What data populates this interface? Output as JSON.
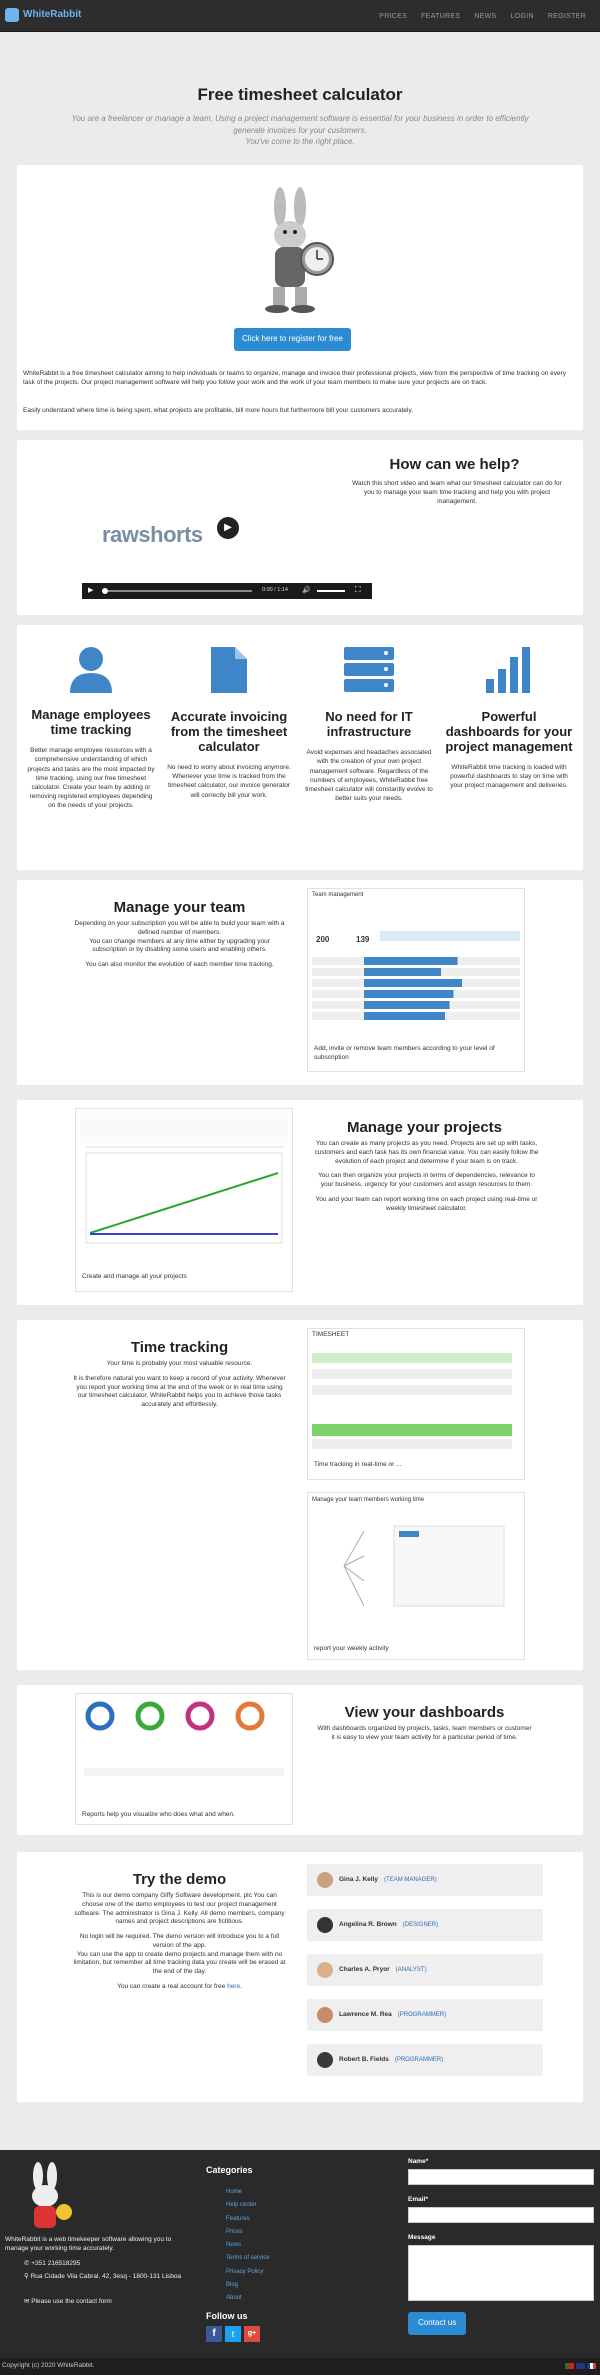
{
  "nav": {
    "brand": "WhiteRabbit",
    "links": [
      "PRICES",
      "FEATURES",
      "NEWS",
      "LOGIN",
      "REGISTER"
    ]
  },
  "hero": {
    "title": "Free timesheet calculator",
    "subtitle": "You are a freelancer or manage a team. Using a project management software is essential for your business in order to efficiently generate invoices for your customers.",
    "subtitle2": "You've come to the right place."
  },
  "intro": {
    "button": "Click here to register for free",
    "p1": "WhiteRabbit is a free timesheet calculator aiming to help individuals or teams to organize, manage and invoice their professional projects, view from the perspective of time tracking on every task of the projects. Our project management software will help you follow your work and the work of your team members to make sure your projects are on track.",
    "p2": "Easily understand where time is being spent, what projects are profitable, bill more hours but furthermore bill your customers accurately."
  },
  "help": {
    "title": "How can we help?",
    "text": "Watch this short video and learn what our timesheet calculator can do for you to manage your team time tracking and help you with project management.",
    "video_logo": "rawshorts",
    "time": "0:00 / 1:14"
  },
  "features": [
    {
      "icon": "user-icon",
      "title": "Manage employees time tracking",
      "text": "Better manage employee resources with a comprehensive understanding of which projects and tasks are the most impacted by time tracking, using our free timesheet calculator. Create your team by adding or removing registered employees depending on the needs of your projects."
    },
    {
      "icon": "document-icon",
      "title": "Accurate invoicing from the timesheet calculator",
      "text": "No need to worry about invoicing anymore. Whenever your time is tracked from the timesheet calculator, our invoice generator will correctly bill your work."
    },
    {
      "icon": "server-icon",
      "title": "No need for IT infrastructure",
      "text": "Avoid expenses and headaches associated with the creation of your own project management software. Regardless of the numbers of employees, WhiteRabbit free timesheet calculator will constantly evolve to better suits your needs."
    },
    {
      "icon": "bar-chart-icon",
      "title": "Powerful dashboards for your project management",
      "text": "WhiteRabbit time tracking is loaded with powerful dashboards to stay on time with your project management and deliveries."
    }
  ],
  "team": {
    "title": "Manage your team",
    "p1": "Depending on your subscription you will be able to build your team with a defined number of members.",
    "p2": "You can change members at any time either by upgrading your subscription or by disabling some users and enabling others.",
    "p3": "You can also monitor the evolution of each member time tracking.",
    "shot_title": "Team management",
    "stat1": "200",
    "stat2": "139",
    "caption": "Add, invite or remove team members according to your level of subscription"
  },
  "projects": {
    "title": "Manage your projects",
    "p1": "You can create as many projects as you need. Projects are set up with tasks, customers and each task has its own financial value. You can easily follow the evolution of each project and determine if your team is on track.",
    "p2": "You can then organize your projects in terms of dependencies, relevance to your business, urgency for your customers and assign resources to them.",
    "p3": "You and your team can report working time on each project using real-time or weekly timesheet calculator.",
    "caption": "Create and manage all your projects"
  },
  "time": {
    "title": "Time tracking",
    "p1": "Your time is probably your most valuable resource.",
    "p2": "It is therefore natural you want to keep a record of your activity. Whenever you report your working time at the end of the week or in real time using our timesheet calculator, WhiteRabbit helps you to achieve those tasks accurately and effortlessly.",
    "shot1_title": "TIMESHEET",
    "caption1": "Time tracking in real-time or ...",
    "shot2_title": "Manage your team members working time",
    "caption2": "report your weekly activity"
  },
  "dash": {
    "title": "View your dashboards",
    "text": "With dashboards organized by projects, tasks, team members or customer it is easy to view your team activity for a particular period of time.",
    "caption": "Reports help you visualize who does what and when."
  },
  "demo": {
    "title": "Try the demo",
    "p1": "This is our demo company Giffy Software development, plc You can choose one of the demo employees to test our project management software. The administrator is Gina J. Kelly. All demo members, company names and project descriptions are fictitious.",
    "p2": "No login will be required. The demo version will introduce you to a full version of the app.",
    "p3": "You can use the app to create demo projects and manage them with no limitation, but remember all time tracking data you create will be erased at the end of the day.",
    "p4": "You can create a real account for free",
    "p4_link": "here",
    "people": [
      {
        "name": "Gina J. Kelly",
        "role": "TEAM MANAGER"
      },
      {
        "name": "Angelina R. Brown",
        "role": "DESIGNER"
      },
      {
        "name": "Charles A. Pryor",
        "role": "ANALYST"
      },
      {
        "name": "Lawrence M. Rea",
        "role": "PROGRAMMER"
      },
      {
        "name": "Robert B. Fields",
        "role": "PROGRAMMER"
      }
    ]
  },
  "footer": {
    "about": "WhiteRabbit is a web timekeeper software allowing you to manage your working time accurately.",
    "phone": "+351 216518295",
    "address": "Rua Cidade Vila Cabral, 42, 3esq - 1800-131 Lisboa",
    "contact": "Please use the contact form",
    "categories_title": "Categories",
    "categories": [
      "Home",
      "Help center",
      "Features",
      "Prices",
      "News",
      "Terms of service",
      "Privacy Policy",
      "Blog",
      "About"
    ],
    "follow": "Follow us",
    "name_label": "Name*",
    "email_label": "Email*",
    "message_label": "Message",
    "submit": "Contact us",
    "copyright": "Copyright (c) 2020 WhiteRabbit."
  }
}
